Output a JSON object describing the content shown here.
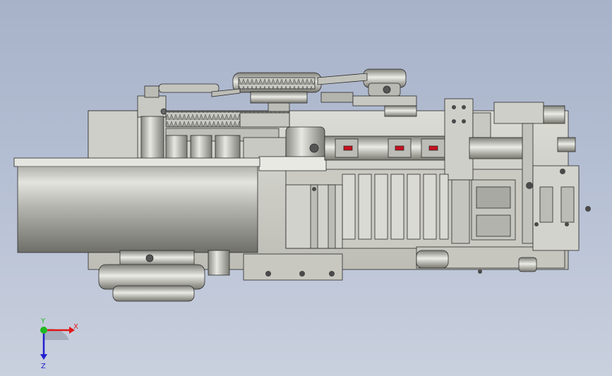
{
  "viewport": {
    "background_top": "#a7b1c8",
    "background_bottom": "#c9d0de"
  },
  "model": {
    "body_color": "#d3d3cd",
    "shade_color": "#8e8e88",
    "outline_color": "#2a2a2a",
    "accent_red": "#c8101e"
  },
  "triad": {
    "x_label": "X",
    "y_label": "Y",
    "z_label": "Z",
    "x_color": "#e01818",
    "y_color": "#1fb81f",
    "z_color": "#2020d0"
  }
}
